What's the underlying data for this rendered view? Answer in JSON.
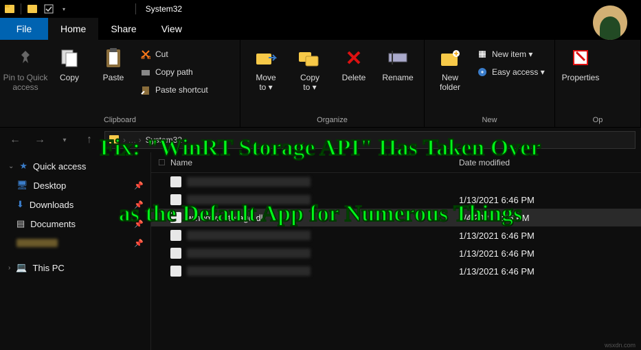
{
  "titlebar": {
    "title": "System32"
  },
  "tabs": {
    "file": "File",
    "home": "Home",
    "share": "Share",
    "view": "View"
  },
  "ribbon": {
    "pin_label": "Pin to Quick\naccess",
    "copy": "Copy",
    "paste": "Paste",
    "cut": "Cut",
    "copy_path": "Copy path",
    "paste_shortcut": "Paste shortcut",
    "clipboard_group": "Clipboard",
    "move_to": "Move\nto ▾",
    "copy_to": "Copy\nto ▾",
    "delete": "Delete",
    "rename": "Rename",
    "organize_group": "Organize",
    "new_folder": "New\nfolder",
    "new_item": "New item ▾",
    "easy_access": "Easy access ▾",
    "new_group": "New",
    "properties": "Properties",
    "open_group": "Op"
  },
  "address": {
    "segment": "System32"
  },
  "sidebar": {
    "items": [
      {
        "label": "Quick access",
        "icon": "star",
        "pin": false
      },
      {
        "label": "Desktop",
        "icon": "desktop",
        "pin": true
      },
      {
        "label": "Downloads",
        "icon": "down",
        "pin": true
      },
      {
        "label": "Documents",
        "icon": "doc",
        "pin": true
      },
      {
        "label": "",
        "icon": "blank",
        "pin": true
      },
      {
        "label": "This PC",
        "icon": "pc",
        "pin": false
      }
    ]
  },
  "columns": {
    "name_hdr": "Name",
    "size_hdr": "Date modified"
  },
  "rows": [
    {
      "name": "",
      "date": "",
      "blur": true
    },
    {
      "name": "",
      "date": "1/13/2021 6:46 PM",
      "blur": true
    },
    {
      "name": "windows.storage.dll",
      "date": "8/4/2021 6:06 PM",
      "blur": false,
      "sel": true
    },
    {
      "name": "",
      "date": "1/13/2021 6:46 PM",
      "blur": true
    },
    {
      "name": "",
      "date": "1/13/2021 6:46 PM",
      "blur": true
    },
    {
      "name": "",
      "date": "1/13/2021 6:46 PM",
      "blur": true
    }
  ],
  "overlay": {
    "line1": "Fix: \"WinRT Storage API\" Has Taken Over",
    "line2": "as the Default App for Numerous Things"
  },
  "watermark": "wsxdn.com"
}
